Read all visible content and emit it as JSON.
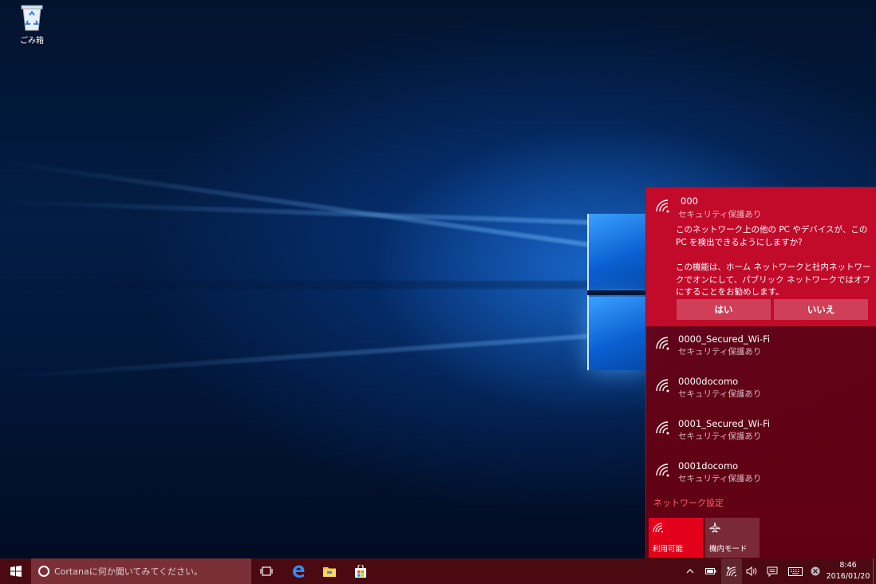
{
  "desktop": {
    "recycle_bin_label": "ごみ箱"
  },
  "flyout": {
    "active_network": {
      "name": "000",
      "status": "セキュリティ保護あり",
      "prompt_1": "このネットワーク上の他の PC やデバイスが、この PC を検出できるようにしますか?",
      "prompt_2": "この機能は、ホーム ネットワークと社内ネットワークでオンにして、パブリック ネットワークではオフにすることをお勧めします。",
      "yes_label": "はい",
      "no_label": "いいえ"
    },
    "networks": [
      {
        "name": "0000_Secured_Wi-Fi",
        "status": "セキュリティ保護あり"
      },
      {
        "name": "0000docomo",
        "status": "セキュリティ保護あり"
      },
      {
        "name": "0001_Secured_Wi-Fi",
        "status": "セキュリティ保護あり"
      },
      {
        "name": "0001docomo",
        "status": "セキュリティ保護あり"
      }
    ],
    "settings_link": "ネットワーク設定",
    "tiles": [
      {
        "label": "利用可能",
        "icon": "wifi-icon",
        "active": true,
        "color": "#e3001b"
      },
      {
        "label": "機内モード",
        "icon": "airplane-icon",
        "active": false,
        "color": "#7a2a36"
      }
    ]
  },
  "taskbar": {
    "search_placeholder": "Cortanaに何か聞いてみてください。",
    "clock_time": "8:46",
    "clock_date": "2016/01/20"
  },
  "colors": {
    "accent": "#c20a2a",
    "flyout_bg": "#680012",
    "taskbar_bg": "#4b0a12",
    "link": "#ff5f73"
  }
}
